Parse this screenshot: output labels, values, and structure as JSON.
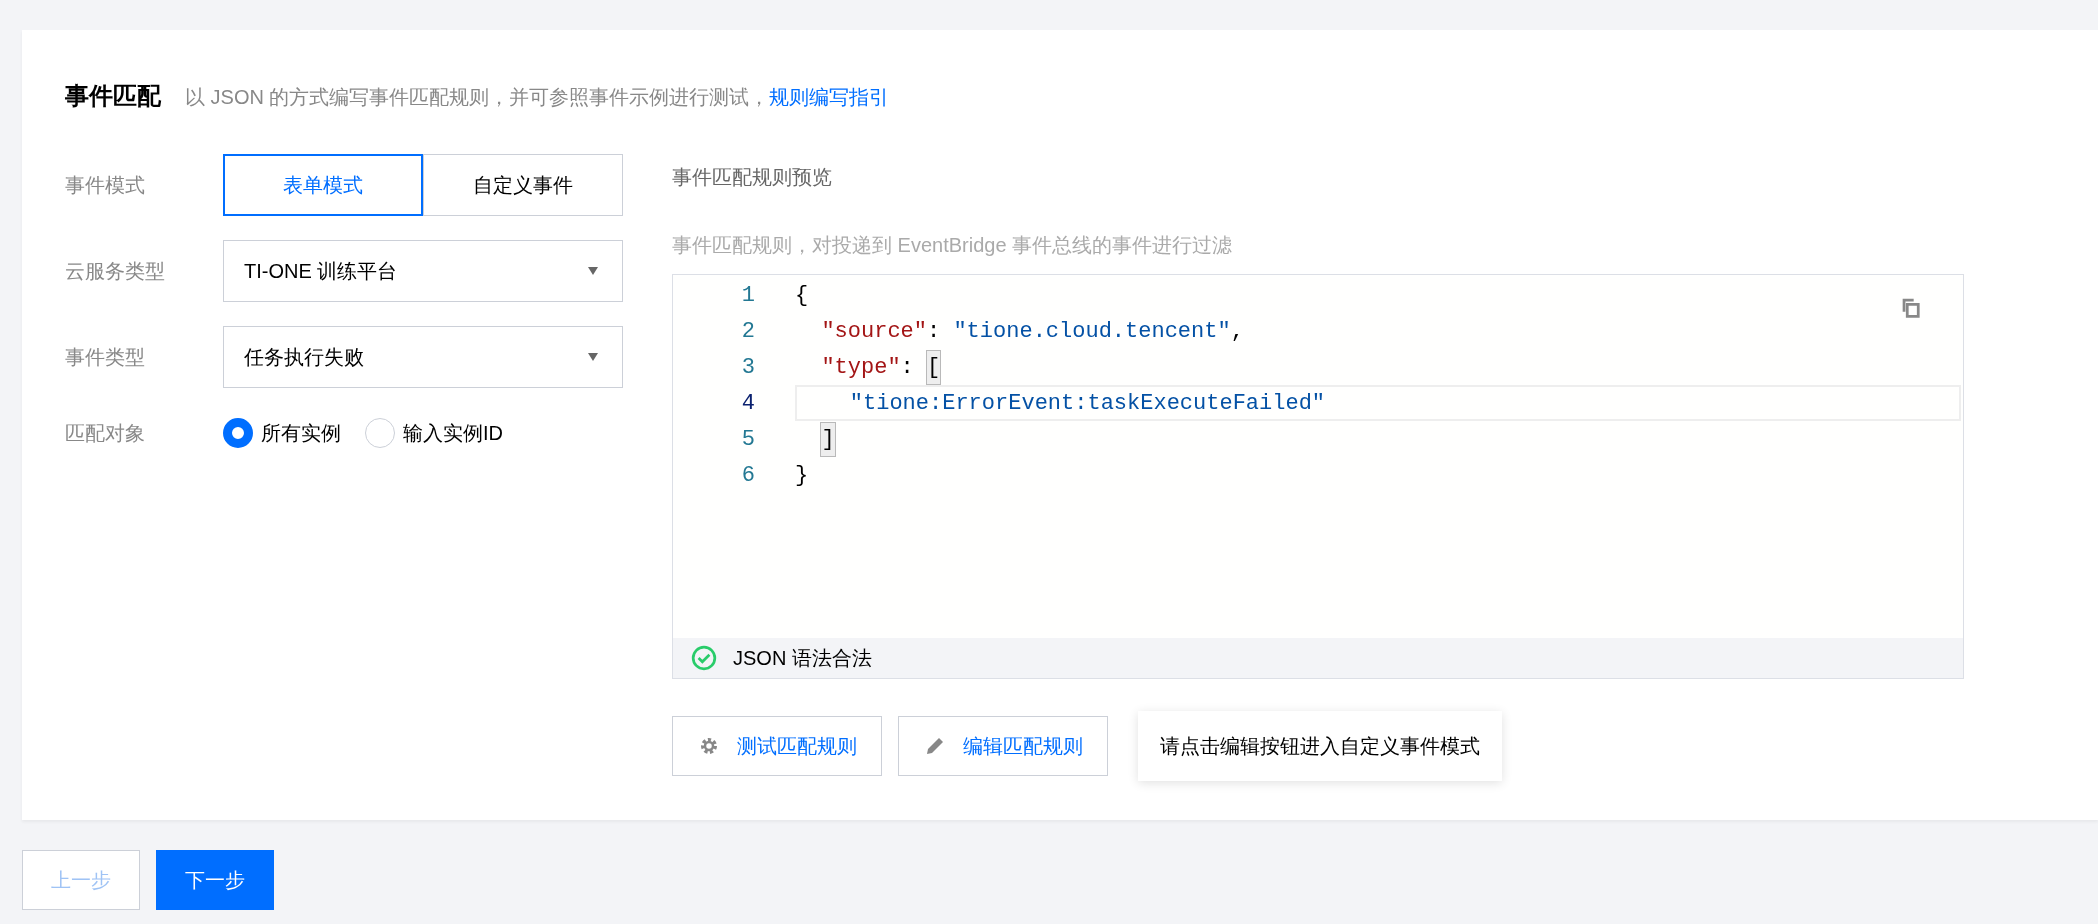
{
  "section": {
    "title": "事件匹配",
    "description": "以 JSON 的方式编写事件匹配规则，并可参照事件示例进行测试，",
    "guide_link": "规则编写指引"
  },
  "form": {
    "mode": {
      "label": "事件模式",
      "options": [
        {
          "label": "表单模式",
          "selected": true
        },
        {
          "label": "自定义事件",
          "selected": false
        }
      ]
    },
    "service_type": {
      "label": "云服务类型",
      "value": "TI-ONE 训练平台"
    },
    "event_type": {
      "label": "事件类型",
      "value": "任务执行失败"
    },
    "match_target": {
      "label": "匹配对象",
      "options": [
        {
          "label": "所有实例",
          "selected": true
        },
        {
          "label": "输入实例ID",
          "selected": false
        }
      ]
    }
  },
  "preview": {
    "title": "事件匹配规则预览",
    "hint": "事件匹配规则，对投递到 EventBridge 事件总线的事件进行过滤",
    "editor": {
      "lines": [
        {
          "number": "1",
          "active": false,
          "tokens": [
            {
              "kind": "punct",
              "text": "{"
            }
          ]
        },
        {
          "number": "2",
          "active": false,
          "tokens": [
            {
              "kind": "key",
              "text": "\"source\""
            },
            {
              "kind": "punct",
              "text": ": "
            },
            {
              "kind": "string",
              "text": "\"tione.cloud.tencent\""
            },
            {
              "kind": "punct",
              "text": ","
            }
          ]
        },
        {
          "number": "3",
          "active": false,
          "tokens": [
            {
              "kind": "key",
              "text": "\"type\""
            },
            {
              "kind": "punct",
              "text": ": "
            },
            {
              "kind": "bracket",
              "text": "["
            }
          ]
        },
        {
          "number": "4",
          "active": true,
          "tokens": [
            {
              "kind": "string",
              "text": "\"tione:ErrorEvent:taskExecuteFailed\""
            }
          ]
        },
        {
          "number": "5",
          "active": false,
          "tokens": [
            {
              "kind": "bracket",
              "text": "]"
            }
          ]
        },
        {
          "number": "6",
          "active": false,
          "tokens": [
            {
              "kind": "punct",
              "text": "}"
            }
          ]
        }
      ],
      "status": {
        "valid": true,
        "text": "JSON 语法合法"
      }
    },
    "buttons": [
      {
        "kind": "test",
        "label": "测试匹配规则"
      },
      {
        "kind": "edit",
        "label": "编辑匹配规则"
      }
    ],
    "tooltip": "请点击编辑按钮进入自定义事件模式"
  },
  "footer": {
    "buttons": [
      {
        "label": "上一步",
        "primary": false,
        "disabled": true
      },
      {
        "label": "下一步",
        "primary": true,
        "disabled": false
      }
    ]
  }
}
